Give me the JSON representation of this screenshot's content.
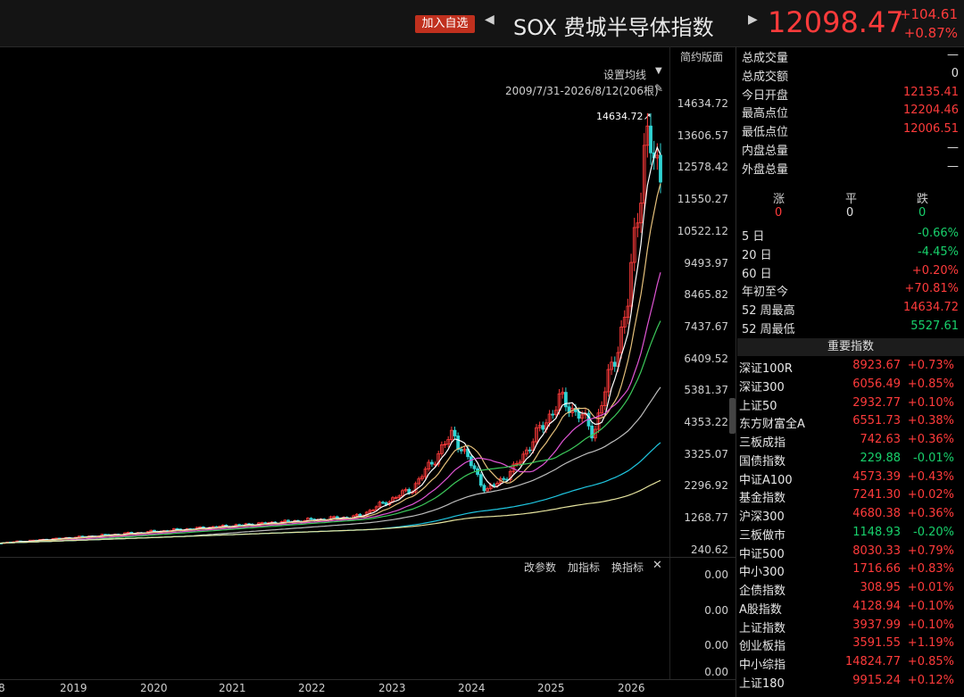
{
  "header": {
    "add_watchlist": "加入自选",
    "prev_arrow": "◀",
    "next_arrow": "▶",
    "title": "SOX 费城半导体指数",
    "price": "12098.47",
    "change": "+104.61",
    "change_pct": "+0.87%"
  },
  "chart": {
    "simple_layout": "简约版面",
    "ma_settings": "设置均线",
    "range": "2009/7/31-2026/8/12(206根)",
    "peak_label": "14634.72↗",
    "yaxis": [
      "14634.72",
      "13606.57",
      "12578.42",
      "11550.27",
      "10522.12",
      "9493.97",
      "8465.82",
      "7437.67",
      "6409.52",
      "5381.37",
      "4353.22",
      "3325.07",
      "2296.92",
      "1268.77",
      "240.62"
    ],
    "xaxis": [
      "8",
      "2019",
      "2020",
      "2021",
      "2022",
      "2023",
      "2024",
      "2025",
      "2026"
    ],
    "sub_yaxis": [
      "0.00",
      "0.00",
      "0.00",
      "0.00"
    ],
    "sub_buttons": {
      "params": "改参数",
      "add": "加指标",
      "switch": "换指标",
      "close": "✕"
    }
  },
  "stats": [
    {
      "label": "总成交量",
      "value": "—"
    },
    {
      "label": "总成交额",
      "value": "0"
    },
    {
      "label": "今日开盘",
      "value": "12135.41"
    },
    {
      "label": "最高点位",
      "value": "12204.46"
    },
    {
      "label": "最低点位",
      "value": "12006.51"
    },
    {
      "label": "内盘总量",
      "value": "—"
    },
    {
      "label": "外盘总量",
      "value": "—"
    }
  ],
  "breadth": {
    "labels": [
      "涨",
      "平",
      "跌"
    ],
    "values": [
      "0",
      "0",
      "0"
    ]
  },
  "periods": [
    {
      "label": "5 日",
      "value": "-0.66%"
    },
    {
      "label": "20 日",
      "value": "-4.45%"
    },
    {
      "label": "60 日",
      "value": "+0.20%"
    },
    {
      "label": "年初至今",
      "value": "+70.81%"
    },
    {
      "label": "52 周最高",
      "value": "14634.72"
    },
    {
      "label": "52 周最低",
      "value": "5527.61"
    }
  ],
  "indices_title": "重要指数",
  "indices": [
    {
      "name": "深证100R",
      "value": "8923.67",
      "pct": "+0.73%"
    },
    {
      "name": "深证300",
      "value": "6056.49",
      "pct": "+0.85%"
    },
    {
      "name": "上证50",
      "value": "2932.77",
      "pct": "+0.10%"
    },
    {
      "name": "东方财富全A",
      "value": "6551.73",
      "pct": "+0.38%"
    },
    {
      "name": "三板成指",
      "value": "742.63",
      "pct": "+0.36%"
    },
    {
      "name": "国债指数",
      "value": "229.88",
      "pct": "-0.01%"
    },
    {
      "name": "中证A100",
      "value": "4573.39",
      "pct": "+0.43%"
    },
    {
      "name": "基金指数",
      "value": "7241.30",
      "pct": "+0.02%"
    },
    {
      "name": "沪深300",
      "value": "4680.38",
      "pct": "+0.36%"
    },
    {
      "name": "三板做市",
      "value": "1148.93",
      "pct": "-0.20%"
    },
    {
      "name": "中证500",
      "value": "8030.33",
      "pct": "+0.79%"
    },
    {
      "name": "中小300",
      "value": "1716.66",
      "pct": "+0.83%"
    },
    {
      "name": "企债指数",
      "value": "308.95",
      "pct": "+0.01%"
    },
    {
      "name": "A股指数",
      "value": "4128.94",
      "pct": "+0.10%"
    },
    {
      "name": "上证指数",
      "value": "3937.99",
      "pct": "+0.10%"
    },
    {
      "name": "创业板指",
      "value": "3591.55",
      "pct": "+1.19%"
    },
    {
      "name": "中小综指",
      "value": "14824.77",
      "pct": "+0.85%"
    },
    {
      "name": "上证180",
      "value": "9915.24",
      "pct": "+0.12%"
    }
  ],
  "colors": {
    "up": "#ff3b3b",
    "down": "#18d06b",
    "bg": "#000000"
  }
}
